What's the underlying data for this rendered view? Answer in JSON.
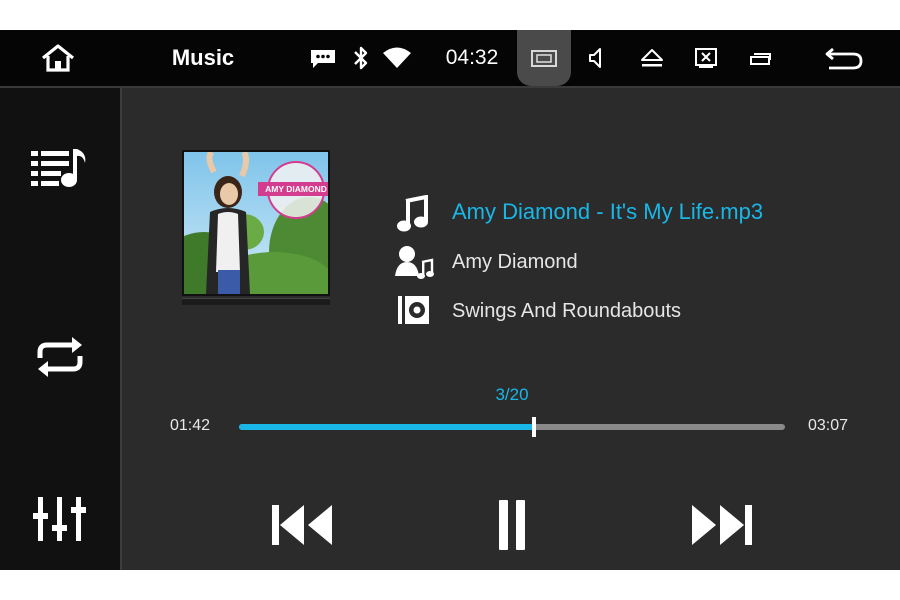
{
  "statusbar": {
    "app_title": "Music",
    "time": "04:32"
  },
  "track": {
    "title": "Amy Diamond - It's My Life.mp3",
    "artist": "Amy Diamond",
    "album": "Swings And Roundabouts",
    "album_art_text": "AMY DIAMOND"
  },
  "playback": {
    "track_position": "3/20",
    "elapsed": "01:42",
    "total": "03:07",
    "progress_fraction": 0.54
  },
  "colors": {
    "accent": "#19b7e8",
    "background": "#2b2b2b",
    "statusbar": "#050505",
    "sidebar": "#111111"
  },
  "icons": {
    "home": "home-icon",
    "message": "message-icon",
    "bluetooth": "bluetooth-icon",
    "wifi": "wifi-icon",
    "screenshot": "screenshot-icon",
    "volume": "volume-icon",
    "eject": "eject-icon",
    "close_window": "close-window-icon",
    "recent_apps": "recent-apps-icon",
    "back": "back-icon",
    "playlist": "playlist-icon",
    "repeat": "repeat-icon",
    "equalizer": "equalizer-icon",
    "previous": "previous-icon",
    "pause": "pause-icon",
    "next": "next-icon"
  }
}
